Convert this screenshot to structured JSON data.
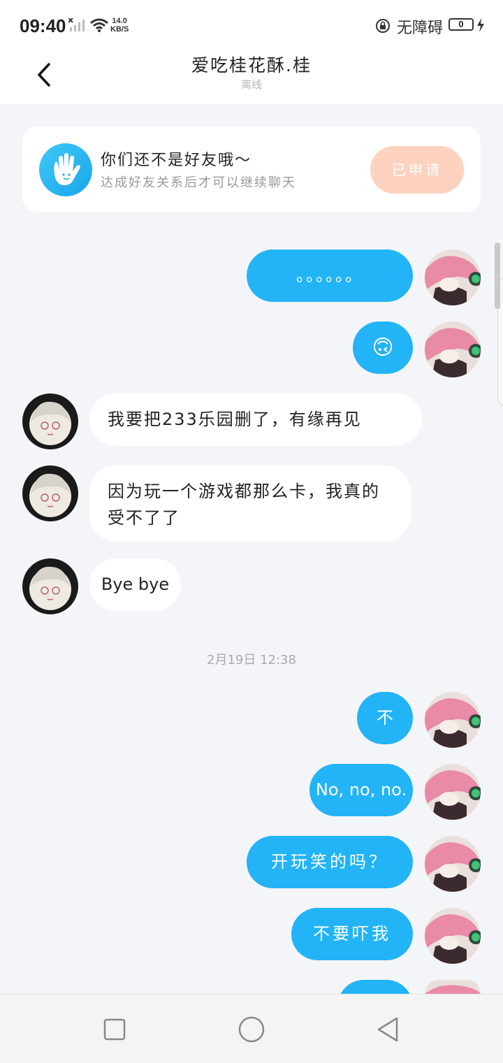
{
  "status_bar": {
    "time": "09:40",
    "network_speed_value": "14.0",
    "network_speed_unit": "KB/S",
    "accessibility_label": "无障碍",
    "battery_level": "0"
  },
  "header": {
    "title": "爱吃桂花酥.桂",
    "status": "离线"
  },
  "friend_card": {
    "title": "你们还不是好友哦～",
    "subtitle": "达成好友关系后才可以继续聊天",
    "button_label": "已申请"
  },
  "messages": [
    {
      "side": "out",
      "text": "。。。。。。"
    },
    {
      "side": "out",
      "text": "🙃"
    },
    {
      "side": "in",
      "text": "我要把233乐园删了，有缘再见"
    },
    {
      "side": "in",
      "text": "因为玩一个游戏都那么卡，我真的受不了了"
    },
    {
      "side": "in",
      "text": "Bye bye"
    },
    {
      "side": "out",
      "text": "不"
    },
    {
      "side": "out",
      "text": "No, no, no."
    },
    {
      "side": "out",
      "text": "开玩笑的吗？"
    },
    {
      "side": "out",
      "text": "不要吓我"
    }
  ],
  "timestamp": "2月19日 12:38",
  "colors": {
    "outgoing_bubble": "#22b4f6",
    "incoming_bubble": "#ffffff",
    "apply_button": "#fdd2bf",
    "background": "#f4f5f8"
  },
  "nav": {
    "recent_icon": "square-icon",
    "home_icon": "circle-icon",
    "back_icon": "triangle-back-icon"
  }
}
